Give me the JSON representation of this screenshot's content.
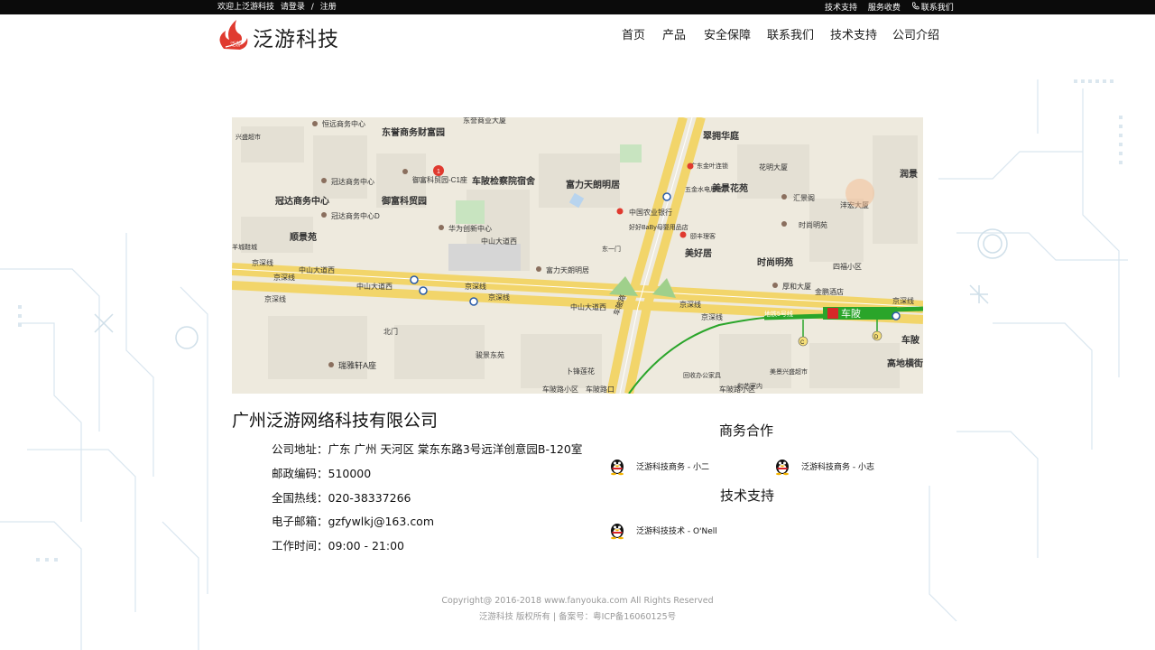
{
  "topbar": {
    "welcome": "欢迎上泛游科技",
    "login": "请登录",
    "separator": "/",
    "register": "注册",
    "links": [
      "技术支持",
      "服务收费",
      "联系我们"
    ]
  },
  "header": {
    "logo_text": "泛游科技",
    "logo_badge": "泛游",
    "nav": [
      "首页",
      "产品",
      "安全保障",
      "联系我们",
      "技术支持",
      "公司介绍"
    ]
  },
  "map": {
    "roads": [
      "京深线",
      "中山大道西",
      "京深线",
      "中山大道西",
      "京深线",
      "京深线",
      "中山大道西",
      "车陂路",
      "京深线",
      "京深线",
      "京深线",
      "地铁5号线",
      "车陂路小区",
      "车陂路口"
    ],
    "places": [
      "恒远商务中心",
      "东誉商务财富园",
      "东誉商业大厦",
      "车陂检察院宿舍",
      "富力天朗明居",
      "翠拥华庭",
      "美景花苑",
      "润景",
      "冠达商务中心",
      "冠达商务中心",
      "御富科贸园",
      "御富科贸园-C1座",
      "冠达商务中心D",
      "顺景苑",
      "华为创新中心",
      "中国农业银行",
      "好好BaBy母婴用品店",
      "汇景阁",
      "时尚明苑",
      "美好居",
      "时尚明苑",
      "厚和大厦",
      "金鹏酒店",
      "四福小区",
      "富力天朗明居",
      "瑞雅轩A座",
      "骏景东苑",
      "卜锋莲花",
      "车陂路小区",
      "高地横街",
      "沣宏大厦",
      "五金水电用品",
      "北门",
      "车陂",
      "京深线",
      "中山大道西",
      "兴盛超市",
      "花明大厦",
      "广东金叶连锁",
      "颐丰理客",
      "东一门",
      "羊城鞋城",
      "回收办公家具",
      "和艺室内",
      "美景兴盛超市"
    ],
    "metro_station": "车陂",
    "metro_exits": [
      "C",
      "D"
    ],
    "marker_number": "1"
  },
  "company": {
    "name": "广州泛游网络科技有限公司",
    "address": "公司地址：广东 广州 天河区 棠东东路3号远洋创意园B-120室",
    "postcode": "邮政编码：510000",
    "hotline": "全国热线：020-38337266",
    "email": "电子邮箱：gzfywlkj@163.com",
    "hours": "工作时间：09:00 - 21:00"
  },
  "business": {
    "title": "商务合作",
    "contacts": [
      "泛游科技商务 - 小二",
      "泛游科技商务 - 小志"
    ]
  },
  "support": {
    "title": "技术支持",
    "contacts": [
      "泛游科技技术 - O'Nell"
    ]
  },
  "footer": {
    "copyright": "Copyright@ 2016-2018 www.fanyouka.com All Rights Reserved",
    "icp": "泛游科技 版权所有 | 备案号：粤ICP备16060125号"
  },
  "colors": {
    "accent_red": "#e03a2f",
    "metro_green": "#2aa52a",
    "road_yellow": "#f7e07a",
    "topbar_bg": "#0b0b0b"
  }
}
